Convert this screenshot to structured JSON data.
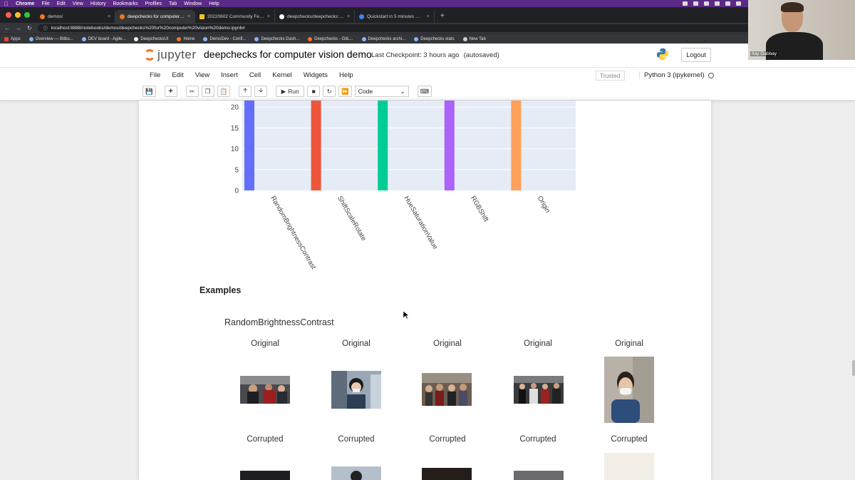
{
  "mac_menu": {
    "items": [
      "Chrome",
      "File",
      "Edit",
      "View",
      "History",
      "Bookmarks",
      "Profiles",
      "Tab",
      "Window",
      "Help"
    ]
  },
  "browser": {
    "tabs": [
      {
        "label": "demos/",
        "active": false
      },
      {
        "label": "deepchecks for computer visio",
        "active": true
      },
      {
        "label": "20220602 Community Feedba",
        "active": false
      },
      {
        "label": "deepchecks/deepchecks: Tes",
        "active": false
      },
      {
        "label": "Quickstart in 5 minutes — Dee",
        "active": false
      }
    ],
    "url": "localhost:8888/notebooks/demos/deepchecks%20for%20computer%20vision%20demo.ipynb#",
    "bookmarks": [
      "Apps",
      "Overview — Bitbu...",
      "DEV board - Agile...",
      "DeepchecksUI",
      "Home",
      "DemoDev - Confl...",
      "Deepchecks Dash...",
      "Deepchecks - GitL...",
      "Deepchecks archi...",
      "Deepchecks stats",
      "New Tab"
    ]
  },
  "jupyter": {
    "logo_text": "jupyter",
    "notebook_title": "deepchecks for computer vision demo",
    "checkpoint": "Last Checkpoint: 3 hours ago",
    "autosave": "(autosaved)",
    "logout": "Logout",
    "menu": [
      "File",
      "Edit",
      "View",
      "Insert",
      "Cell",
      "Kernel",
      "Widgets",
      "Help"
    ],
    "trusted": "Trusted",
    "kernel": "Python 3 (ipykernel)",
    "toolbar": {
      "run_label": "Run",
      "cell_type": "Code"
    }
  },
  "chart_data": {
    "type": "bar",
    "categories": [
      "RandomBrightnessContrast",
      "ShiftScaleRotate",
      "HueSaturationValue",
      "RGBShift",
      "Origin"
    ],
    "colors": [
      "#636efa",
      "#ef553b",
      "#00cc96",
      "#ab63fa",
      "#ffa15a"
    ],
    "values": [
      25,
      25,
      25,
      25,
      25
    ],
    "yticks": [
      0,
      5,
      10,
      15,
      20
    ],
    "ylim": [
      0,
      25
    ],
    "title": "",
    "xlabel": "",
    "ylabel": ""
  },
  "examples": {
    "heading": "Examples",
    "augmentation": "RandomBrightnessContrast",
    "original_labels": [
      "Original",
      "Original",
      "Original",
      "Original",
      "Original"
    ],
    "corrupted_labels": [
      "Corrupted",
      "Corrupted",
      "Corrupted",
      "Corrupted",
      "Corrupted"
    ]
  },
  "webcam": {
    "name": "Itay Gabbay"
  }
}
